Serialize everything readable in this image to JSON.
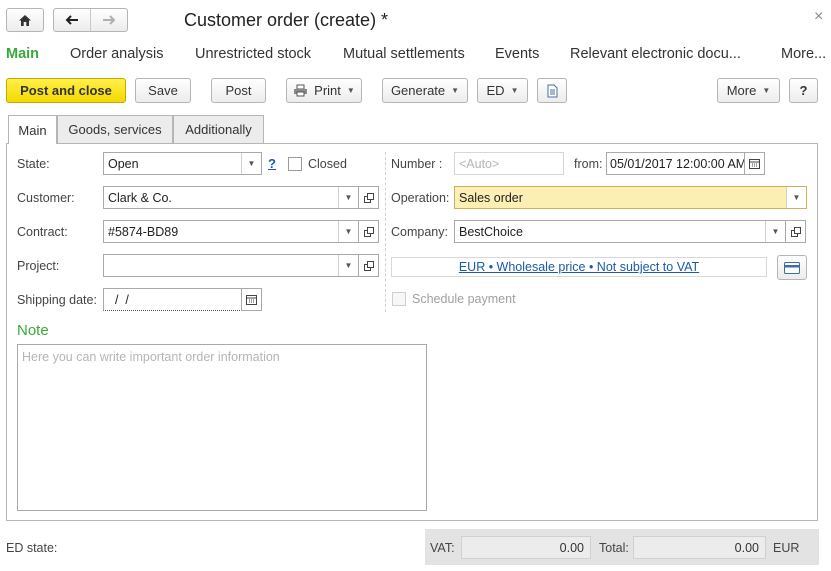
{
  "window": {
    "title": "Customer order (create) *",
    "close_glyph": "×"
  },
  "nav": {
    "items": [
      {
        "label": "Main"
      },
      {
        "label": "Order analysis"
      },
      {
        "label": "Unrestricted stock"
      },
      {
        "label": "Mutual settlements"
      },
      {
        "label": "Events"
      },
      {
        "label": "Relevant electronic docu..."
      },
      {
        "label": "More..."
      }
    ]
  },
  "toolbar": {
    "post_close_label": "Post and close",
    "save_label": "Save",
    "post_label": "Post",
    "print_label": "Print",
    "generate_label": "Generate",
    "ed_label": "ED",
    "more_label": "More",
    "help_label": "?"
  },
  "tabs": [
    {
      "label": "Main"
    },
    {
      "label": "Goods, services"
    },
    {
      "label": "Additionally"
    }
  ],
  "form": {
    "state": {
      "label": "State:",
      "value": "Open",
      "help": "?",
      "closed_label": "Closed"
    },
    "customer": {
      "label": "Customer:",
      "value": "Clark & Co."
    },
    "contract": {
      "label": "Contract:",
      "value": "#5874-BD89"
    },
    "project": {
      "label": "Project:",
      "value": ""
    },
    "shipping_date": {
      "label": "Shipping date:",
      "value": "  /  /"
    },
    "number": {
      "label": "Number :",
      "placeholder": "<Auto>"
    },
    "from": {
      "label": "from:",
      "value": "05/01/2017 12:00:00 AM"
    },
    "operation": {
      "label": "Operation:",
      "value": "Sales order"
    },
    "company": {
      "label": "Company:",
      "value": "BestChoice"
    },
    "price_link": "EUR • Wholesale price • Not subject to VAT",
    "schedule_payment_label": "Schedule payment",
    "note": {
      "title": "Note",
      "placeholder": "Here you can write important order information"
    }
  },
  "footer": {
    "ed_state_label": "ED state:",
    "vat_label": "VAT:",
    "vat_value": "0.00",
    "total_label": "Total:",
    "total_value": "0.00",
    "currency": "EUR"
  },
  "colors": {
    "accent_green": "#3aa83a",
    "primary_yellow": "#f5d800",
    "operation_field": "#fcefb4",
    "link_blue": "#1a5aa8"
  },
  "icons": [
    "home-icon",
    "arrow-left-icon",
    "arrow-right-icon",
    "close-icon",
    "printer-icon",
    "document-icon",
    "calendar-icon",
    "open-icon",
    "card-icon",
    "chevron-down-icon"
  ]
}
